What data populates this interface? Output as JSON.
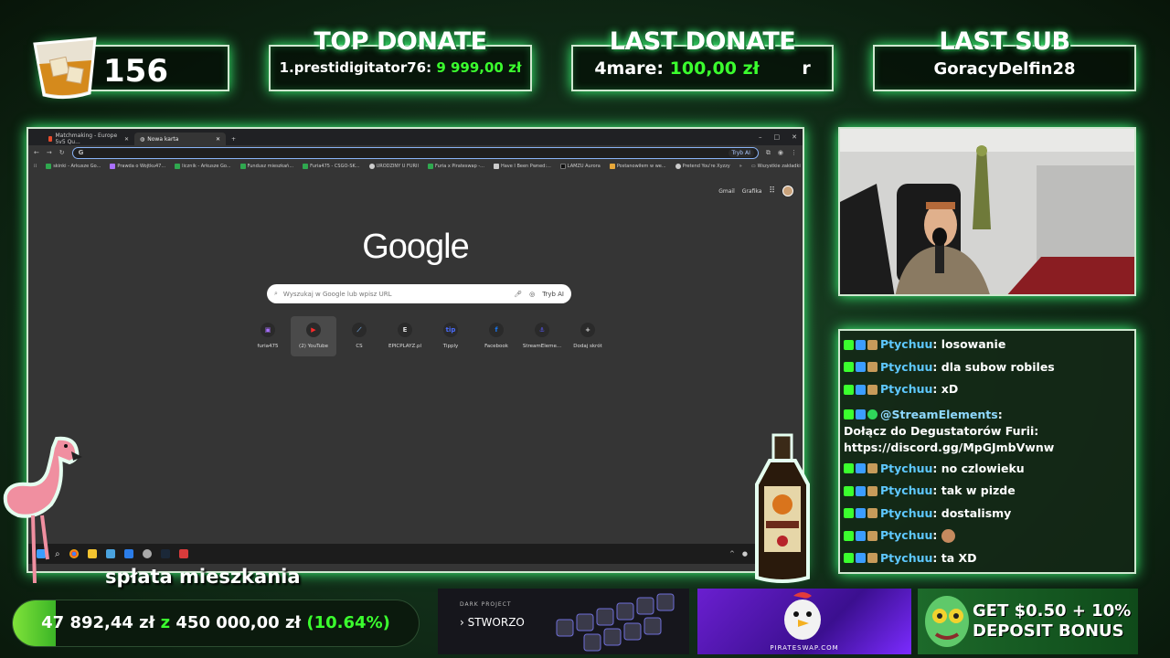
{
  "header": {
    "sub_count": "156",
    "top_donate": {
      "title": "TOP DONATE",
      "entry": "1.prestidigitator76:",
      "amount": "9 999,00 zł"
    },
    "last_donate": {
      "title": "LAST DONATE",
      "name": "4mare:",
      "amount": "100,00 zł",
      "suffix": "r"
    },
    "last_sub": {
      "title": "LAST SUB",
      "name": "GoracyDelfin28"
    }
  },
  "browser": {
    "tabs": [
      {
        "label": "Matchmaking - Europe 5v5 Qu..."
      },
      {
        "label": "Nowa karta"
      }
    ],
    "new_tab_symbol": "+",
    "window_controls": [
      "–",
      "□",
      "✕"
    ],
    "address_value": "G",
    "ai_mode_label": "Tryb AI",
    "bookmarks": [
      {
        "label": "skinki - Arkusze Go...",
        "color": "#2fa84f"
      },
      {
        "label": "Prawda o Wojtku47...",
        "color": "#a970ff"
      },
      {
        "label": "licznik - Arkusze Go...",
        "color": "#2fa84f"
      },
      {
        "label": "Fundusz mieszkań...",
        "color": "#2fa84f"
      },
      {
        "label": "Furia475 - CSGO-SK...",
        "color": "#2fa84f"
      },
      {
        "label": "URODZINY U FURII",
        "color": "#cccccc"
      },
      {
        "label": "Furia x Pirateswap -...",
        "color": "#2fa84f"
      },
      {
        "label": "Have I Been Pwned:...",
        "color": "#cccccc"
      },
      {
        "label": "LAMZU Aurora",
        "color": "#111111"
      },
      {
        "label": "Postanowiłem w we...",
        "color": "#e8a83a"
      },
      {
        "label": "Pretend You're Xyzzy",
        "color": "#cccccc"
      }
    ],
    "bookmarks_overflow": "»",
    "all_bookmarks": "Wszystkie zakładki",
    "top_links": {
      "gmail": "Gmail",
      "images": "Grafika"
    },
    "logo": "Google",
    "search_placeholder": "Wyszukaj w Google lub wpisz URL",
    "search_ai_label": "Tryb AI",
    "shortcuts": [
      {
        "label": "furia475",
        "glyph": "▣",
        "color": "#a970ff"
      },
      {
        "label": "(2) YouTube",
        "glyph": "▶",
        "color": "#ff2a2a"
      },
      {
        "label": "CS",
        "glyph": "⟋",
        "color": "#6fa0d8"
      },
      {
        "label": "EPICPLAYZ.pl",
        "glyph": "E",
        "color": "#dddddd"
      },
      {
        "label": "Tipply",
        "glyph": "tip",
        "color": "#4a6cff"
      },
      {
        "label": "Facebook",
        "glyph": "f",
        "color": "#1877f2"
      },
      {
        "label": "StreamEleme...",
        "glyph": "⚓",
        "color": "#5a5aff"
      },
      {
        "label": "Dodaj skrót",
        "glyph": "+",
        "color": "#dddddd"
      }
    ]
  },
  "chat": [
    {
      "user": "Ptychuu",
      "text": "losowanie"
    },
    {
      "user": "Ptychuu",
      "text": "dla subow robiles"
    },
    {
      "user": "Ptychuu",
      "text": "xD"
    },
    {
      "user": "@StreamElements",
      "text": "Dołącz do Degustatorów Furii: https://discord.gg/MpGJmbVwnw",
      "bot": true
    },
    {
      "user": "Ptychuu",
      "text": "no czlowieku"
    },
    {
      "user": "Ptychuu",
      "text": "tak w pizde"
    },
    {
      "user": "Ptychuu",
      "text": "dostalismy"
    },
    {
      "user": "Ptychuu",
      "text": ""
    },
    {
      "user": "Ptychuu",
      "text": "ta XD"
    }
  ],
  "goal": {
    "title": "spłata mieszkania",
    "current": "47 892,44 zł",
    "separator": "z",
    "target": "450 000,00 zł",
    "percent_label": "(10.64%)",
    "progress": 0.1064
  },
  "ads": {
    "dark_project": {
      "brand": "DARK PROJECT",
      "cta": "› STWORZO"
    },
    "pirateswap": {
      "url": "PIRATESWAP.COM"
    },
    "bonus": {
      "line1": "GET $0.50 + 10%",
      "line2": "DEPOSIT BONUS"
    }
  },
  "colors": {
    "accent_green": "#3bff2e",
    "chat_user": "#5ec8ff",
    "glow": "#3bff78"
  }
}
